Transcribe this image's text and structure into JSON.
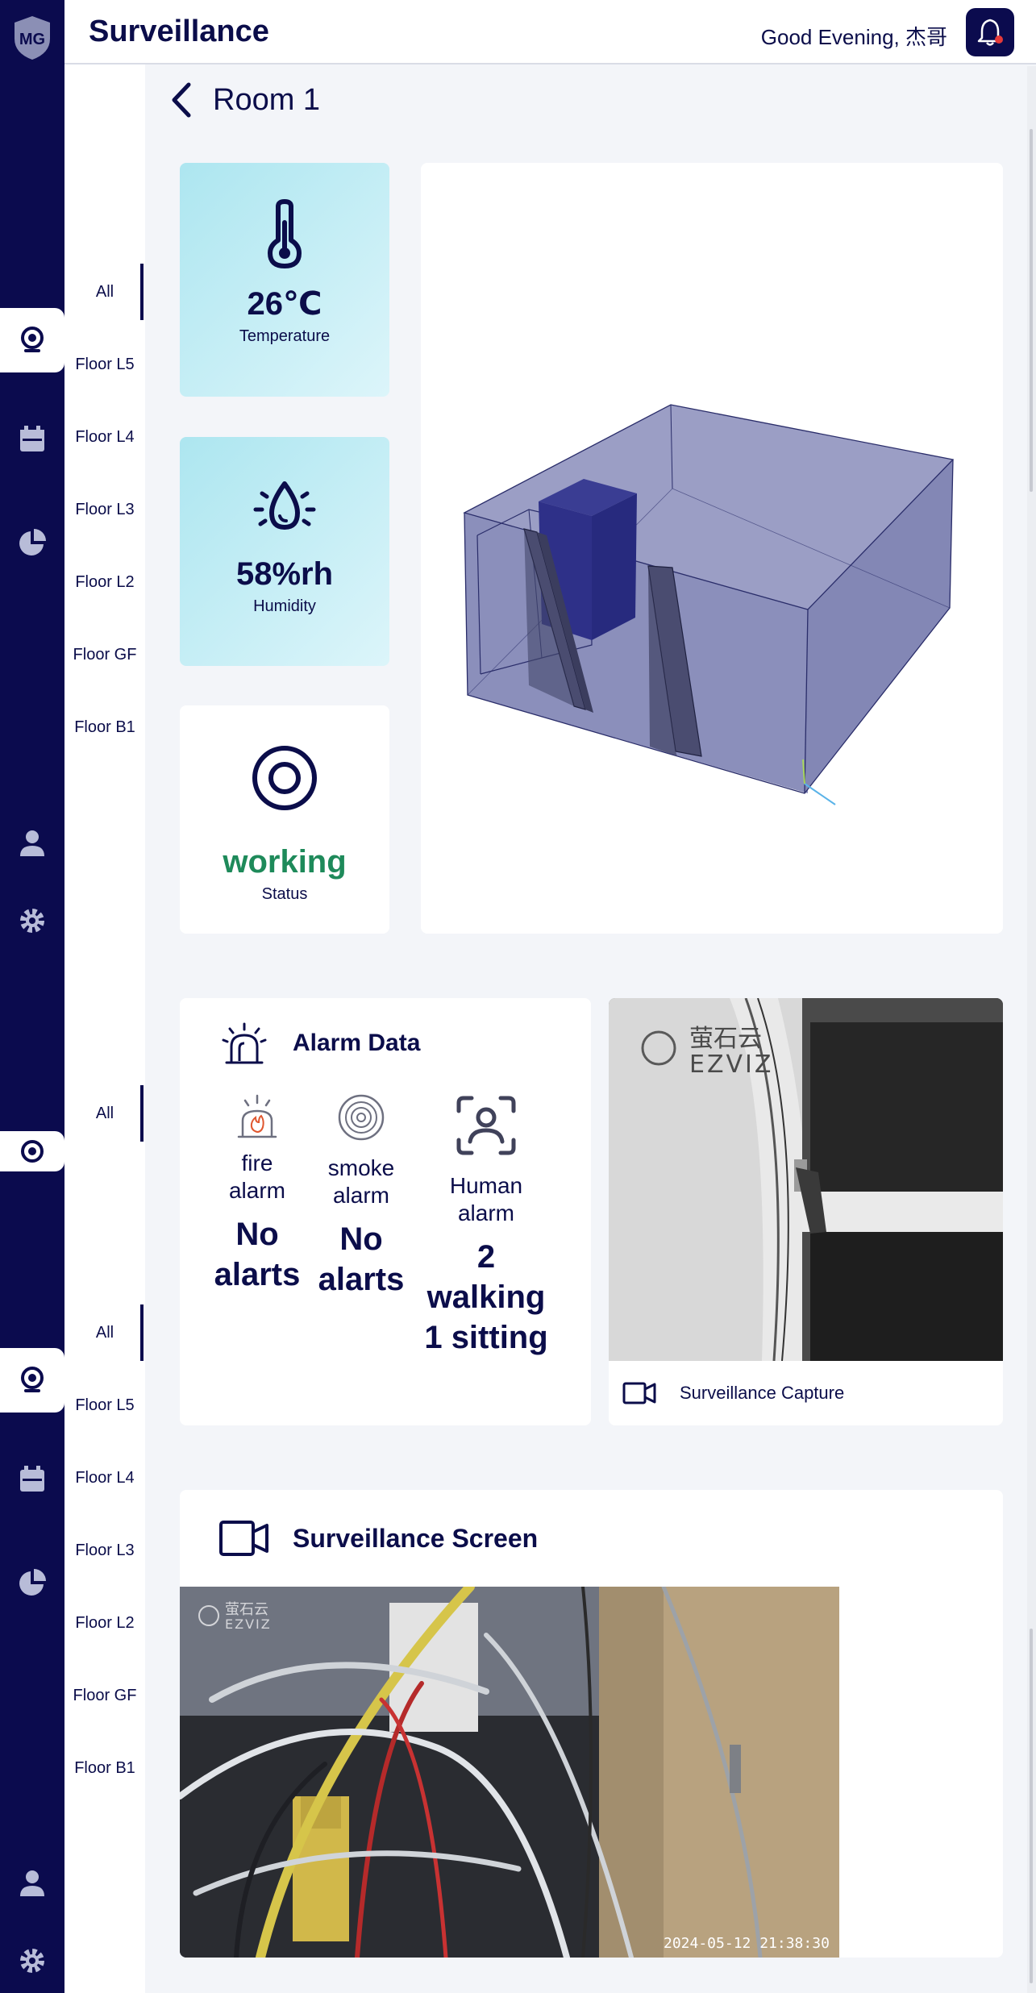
{
  "app": {
    "title": "Surveillance",
    "greeting": "Good Evening, 杰哥",
    "logo_text": "MG"
  },
  "sidebar": {
    "icons": [
      "camera-icon",
      "calendar-icon",
      "pie-chart-icon",
      "user-icon",
      "gear-icon"
    ]
  },
  "floors": {
    "top": [
      "All",
      "Floor L5",
      "Floor L4",
      "Floor L3",
      "Floor L2",
      "Floor GF",
      "Floor B1"
    ],
    "middle": [
      "All"
    ],
    "bottom": [
      "All",
      "Floor L5",
      "Floor L4",
      "Floor L3",
      "Floor L2",
      "Floor GF",
      "Floor B1"
    ]
  },
  "room": {
    "title": "Room 1"
  },
  "stats": {
    "temperature": {
      "value": "26℃",
      "label": "Temperature"
    },
    "humidity": {
      "value": "58%rh",
      "label": "Humidity"
    },
    "status": {
      "value": "working",
      "label": "Status"
    }
  },
  "alarm": {
    "title": "Alarm Data",
    "items": [
      {
        "name": "fire alarm",
        "value": "No alarts",
        "icon": "fire-alarm-icon"
      },
      {
        "name": "smoke alarm",
        "value": "No alarts",
        "icon": "smoke-alarm-icon"
      },
      {
        "name": "Human alarm",
        "value": "2 walking 1 sitting",
        "icon": "human-alarm-icon"
      }
    ]
  },
  "capture": {
    "label": "Surveillance Capture",
    "watermark": "萤石云 EZVIZ"
  },
  "screen": {
    "title": "Surveillance Screen",
    "timestamp": "2024-05-12 21:38:30",
    "watermark": "萤石云 EZVIZ"
  },
  "colors": {
    "navy": "#0b0b4e",
    "cyan": "#ade6f0",
    "working": "#1e8a5a",
    "background": "#f3f5f9"
  }
}
